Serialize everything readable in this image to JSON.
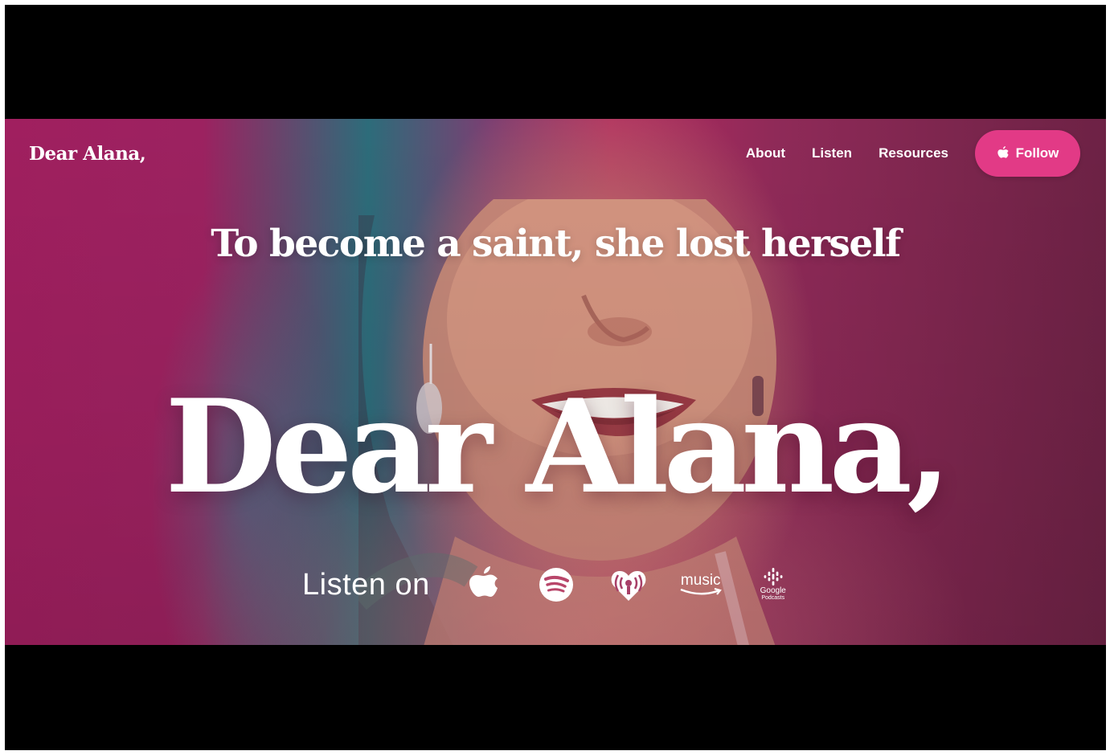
{
  "nav": {
    "logo": "Dear Alana,",
    "links": [
      {
        "label": "About"
      },
      {
        "label": "Listen"
      },
      {
        "label": "Resources"
      }
    ],
    "follow_label": "Follow",
    "follow_icon": "apple-icon"
  },
  "hero": {
    "tagline": "To become a saint, she lost herself",
    "title": "Dear Alana,",
    "listen_label": "Listen on",
    "platforms": [
      {
        "name": "apple-podcasts-icon"
      },
      {
        "name": "spotify-icon"
      },
      {
        "name": "iheartradio-icon"
      },
      {
        "name": "amazon-music-icon",
        "text": "music"
      },
      {
        "name": "google-podcasts-icon",
        "text": "Google",
        "subtext": "Podcasts"
      }
    ]
  },
  "colors": {
    "accent": "#e23a86",
    "background": "#8e2158",
    "text": "#ffffff",
    "letterbox": "#000000"
  }
}
